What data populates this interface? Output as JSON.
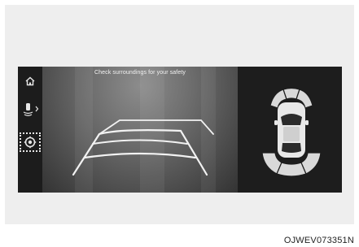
{
  "camera_view": {
    "caution_text": "Check surroundings for your safety"
  },
  "sidebar": {
    "items": [
      {
        "icon": "home-icon"
      },
      {
        "icon": "parking-sensor-icon",
        "has_chevron": true
      },
      {
        "icon": "camera-settings-icon",
        "selected": true
      }
    ]
  },
  "figure": {
    "code": "OJWEV073351N"
  },
  "colors": {
    "screen_background": "#1a1a1a",
    "guide_lines": "#f2f2f2",
    "sensor_zones": "#d9d9d9",
    "selection_outline": "#e8e8e8"
  }
}
